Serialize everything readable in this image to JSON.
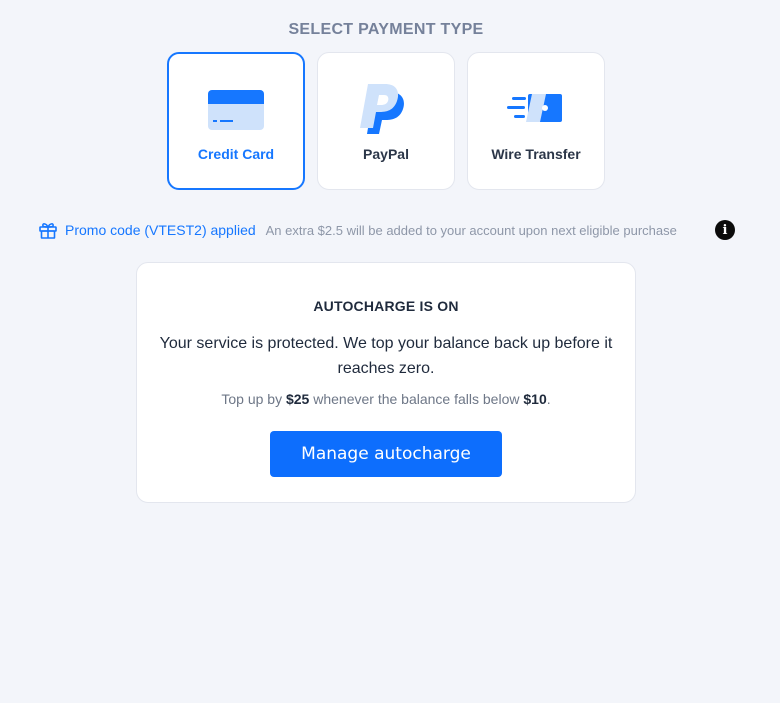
{
  "header": {
    "title": "SELECT PAYMENT TYPE"
  },
  "payment_types": [
    {
      "label": "Credit Card",
      "icon": "credit-card-icon",
      "selected": true
    },
    {
      "label": "PayPal",
      "icon": "paypal-icon",
      "selected": false
    },
    {
      "label": "Wire Transfer",
      "icon": "wire-transfer-icon",
      "selected": false
    }
  ],
  "promo": {
    "applied_text": "Promo code (VTEST2) applied",
    "extra_text": "An extra $2.5 will be added to your account upon next eligible purchase",
    "icon": "gift-icon",
    "info_icon": "info-icon"
  },
  "autocharge": {
    "title": "AUTOCHARGE IS ON",
    "description": "Your service is protected. We top your balance back up before it reaches zero.",
    "rule_prefix": "Top up by ",
    "topup_amount": "$25",
    "rule_middle": " whenever the balance falls below ",
    "threshold_amount": "$10",
    "rule_suffix": ".",
    "button_label": "Manage autocharge"
  },
  "colors": {
    "accent": "#1677ff",
    "button": "#0d6efd",
    "background": "#f3f5fa"
  }
}
